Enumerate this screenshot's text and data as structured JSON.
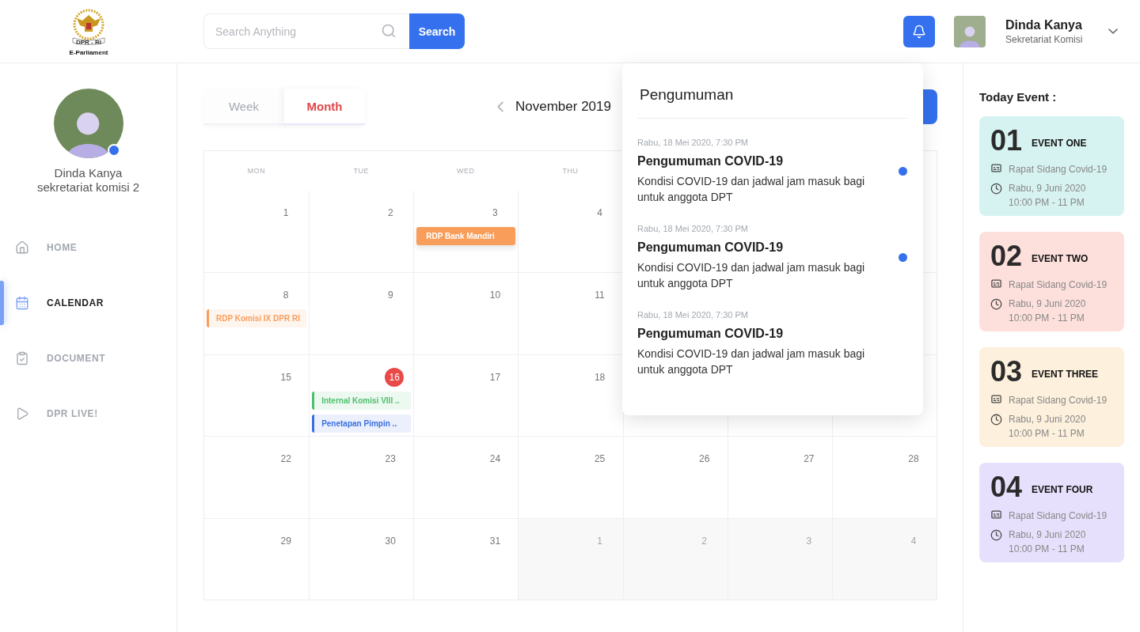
{
  "header": {
    "logo_text": "E-Parliament",
    "emblem_text": "DPR - RI",
    "search": {
      "placeholder": "Search Anything",
      "button": "Search"
    },
    "user": {
      "name": "Dinda Kanya",
      "role": "Sekretariat Komisi"
    }
  },
  "sidebar": {
    "profile": {
      "name": "Dinda Kanya",
      "subtitle": "sekretariat komisi 2",
      "online": true
    },
    "items": [
      {
        "kind": "home",
        "label": "HOME",
        "selected": false
      },
      {
        "kind": "calendar",
        "label": "CALENDAR",
        "selected": true
      },
      {
        "kind": "document",
        "label": "DOCUMENT",
        "selected": false
      },
      {
        "kind": "live",
        "label": "DPR LIVE!",
        "selected": false
      }
    ]
  },
  "calendar": {
    "tabs": [
      {
        "label": "Week",
        "selected": false
      },
      {
        "label": "Month",
        "selected": true
      }
    ],
    "month": "November 2019",
    "weekdays": [
      "MON",
      "TUE",
      "WED",
      "THU"
    ],
    "weeks": [
      [
        {
          "date": "1",
          "today": false,
          "outside": false
        },
        {
          "date": "2",
          "today": false,
          "outside": false
        },
        {
          "date": "3",
          "today": false,
          "outside": false,
          "events": [
            {
              "kind": "solid",
              "label": "RDP Bank Mandiri",
              "color": "#f99d5b"
            }
          ]
        },
        {
          "date": "4",
          "today": false,
          "outside": false
        }
      ],
      [
        {
          "date": "8",
          "today": false,
          "outside": false,
          "events": [
            {
              "kind": "tinted",
              "label": "RDP Komisi IX DPR RI",
              "color": "#f99d5b"
            }
          ]
        },
        {
          "date": "9",
          "today": false,
          "outside": false
        },
        {
          "date": "10",
          "today": false,
          "outside": false
        },
        {
          "date": "11",
          "today": false,
          "outside": false
        }
      ],
      [
        {
          "date": "15",
          "today": false,
          "outside": false
        },
        {
          "date": "16",
          "today": true,
          "outside": false,
          "events": [
            {
              "kind": "tinted",
              "label": "Internal Komisi VIII ..",
              "color": "#4cbf6b"
            },
            {
              "kind": "tinted",
              "label": "Penetapan Pimpin ..",
              "color": "#3a6fe0"
            }
          ]
        },
        {
          "date": "17",
          "today": false,
          "outside": false
        },
        {
          "date": "18",
          "today": false,
          "outside": false
        }
      ],
      [
        {
          "date": "22",
          "today": false,
          "outside": false
        },
        {
          "date": "23",
          "today": false,
          "outside": false
        },
        {
          "date": "24",
          "today": false,
          "outside": false
        },
        {
          "date": "25",
          "today": false,
          "outside": false
        },
        {
          "date": "26",
          "today": false,
          "outside": false
        },
        {
          "date": "27",
          "today": false,
          "outside": false
        },
        {
          "date": "28",
          "today": false,
          "outside": false
        }
      ],
      [
        {
          "date": "29",
          "today": false,
          "outside": false
        },
        {
          "date": "30",
          "today": false,
          "outside": false
        },
        {
          "date": "31",
          "today": false,
          "outside": false
        },
        {
          "date": "1",
          "today": false,
          "outside": true
        },
        {
          "date": "2",
          "today": false,
          "outside": true
        },
        {
          "date": "3",
          "today": false,
          "outside": true
        },
        {
          "date": "4",
          "today": false,
          "outside": true
        }
      ]
    ]
  },
  "announcements": {
    "title": "Pengumuman",
    "items": [
      {
        "time": "Rabu, 18 Mei 2020, 7:30 PM",
        "title": "Pengumuman COVID-19",
        "body": "Kondisi COVID-19 dan jadwal jam masuk bagi untuk anggota DPT",
        "unread": true
      },
      {
        "time": "Rabu, 18 Mei 2020, 7:30 PM",
        "title": "Pengumuman COVID-19",
        "body": "Kondisi COVID-19 dan jadwal jam masuk bagi untuk anggota DPT",
        "unread": true
      },
      {
        "time": "Rabu, 18 Mei 2020, 7:30 PM",
        "title": "Pengumuman COVID-19",
        "body": "Kondisi COVID-19 dan jadwal jam masuk bagi untuk anggota DPT",
        "unread": false
      }
    ]
  },
  "today_events": {
    "title": "Today Event :",
    "items": [
      {
        "number": "01",
        "title": "EVENT ONE",
        "subject": "Rapat Sidang Covid-19",
        "date": "Rabu, 9 Juni 2020",
        "time": "10:00 PM - 11 PM",
        "color": "#d7f3f1"
      },
      {
        "number": "02",
        "title": "EVENT TWO",
        "subject": "Rapat Sidang Covid-19",
        "date": "Rabu, 9 Juni 2020",
        "time": "10:00 PM - 11 PM",
        "color": "#fde0dc"
      },
      {
        "number": "03",
        "title": "EVENT THREE",
        "subject": "Rapat Sidang Covid-19",
        "date": "Rabu, 9 Juni 2020",
        "time": "10:00 PM - 11 PM",
        "color": "#fdf0dc"
      },
      {
        "number": "04",
        "title": "EVENT FOUR",
        "subject": "Rapat Sidang Covid-19",
        "date": "Rabu, 9 Juni 2020",
        "time": "10:00 PM - 11 PM",
        "color": "#e7e0fc"
      }
    ]
  }
}
